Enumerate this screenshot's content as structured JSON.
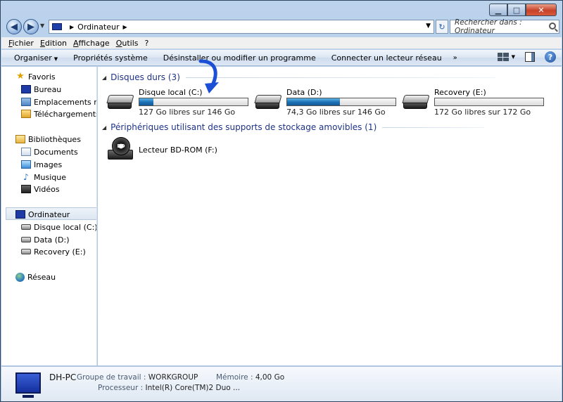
{
  "window": {
    "caption": {
      "min": "▁",
      "max": "□",
      "close": "✕"
    }
  },
  "address_bar": {
    "crumb": "Ordinateur",
    "search_placeholder": "Rechercher dans : Ordinateur"
  },
  "menubar": [
    "Fichier",
    "Edition",
    "Affichage",
    "Outils",
    "?"
  ],
  "commandbar": {
    "organize": "Organiser",
    "items": [
      "Propriétés système",
      "Désinstaller ou modifier un programme",
      "Connecter un lecteur réseau"
    ],
    "more": "»",
    "help": "?"
  },
  "navpane": {
    "favorites": "Favoris",
    "fav_items": [
      "Bureau",
      "Emplacements récen",
      "Téléchargements"
    ],
    "libraries": "Bibliothèques",
    "lib_items": [
      "Documents",
      "Images",
      "Musique",
      "Vidéos"
    ],
    "computer": "Ordinateur",
    "computer_items": [
      "Disque local (C:)",
      "Data (D:)",
      "Recovery (E:)"
    ],
    "network": "Réseau"
  },
  "content": {
    "group_hard_disks": "Disques durs (3)",
    "group_removable": "Périphériques utilisant des supports de stockage amovibles (1)",
    "drives": [
      {
        "name": "Disque local (C:)",
        "free": "127 Go libres sur 146 Go",
        "used_fraction": 0.13
      },
      {
        "name": "Data (D:)",
        "free": "74,3 Go libres sur 146 Go",
        "used_fraction": 0.49
      },
      {
        "name": "Recovery (E:)",
        "free": "172 Go libres sur 172 Go",
        "used_fraction": 0.0
      }
    ],
    "removable": [
      {
        "name": "Lecteur BD-ROM (F:)",
        "badge": "BD"
      }
    ]
  },
  "details": {
    "name": "DH-PC",
    "workgroup_label": "Groupe de travail :",
    "workgroup": "WORKGROUP",
    "memory_label": "Mémoire :",
    "memory": "4,00 Go",
    "processor_label": "Processeur :",
    "processor": "Intel(R) Core(TM)2 Duo ..."
  },
  "colors": {
    "accent": "#1e3287",
    "drive_fill": "#1b6fb4",
    "annotation_arrow": "#1a4fd6"
  }
}
